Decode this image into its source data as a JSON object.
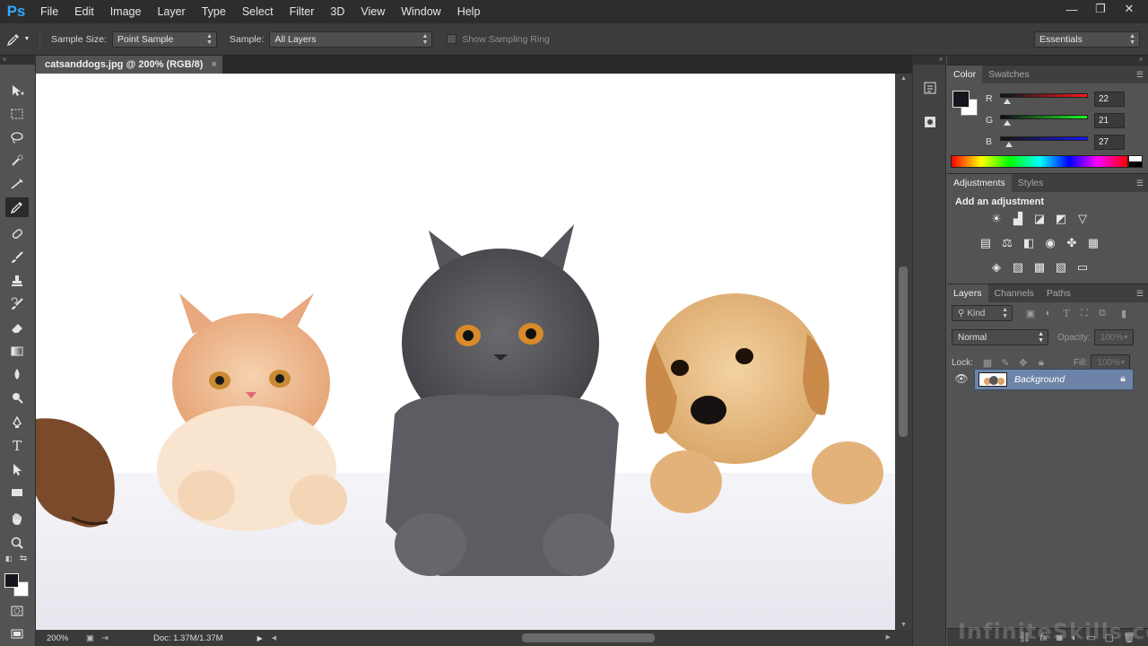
{
  "app": {
    "logo": "Ps"
  },
  "menu": [
    "File",
    "Edit",
    "Image",
    "Layer",
    "Type",
    "Select",
    "Filter",
    "3D",
    "View",
    "Window",
    "Help"
  ],
  "window_controls": {
    "minimize": "—",
    "restore": "❐",
    "close": "✕"
  },
  "options": {
    "sample_size_label": "Sample Size:",
    "sample_size_value": "Point Sample",
    "sample_label": "Sample:",
    "sample_value": "All Layers",
    "show_ring_label": "Show Sampling Ring",
    "show_ring_checked": false,
    "workspace": "Essentials"
  },
  "document": {
    "tab_title": "catsanddogs.jpg @ 200% (RGB/8)",
    "close": "×",
    "zoom": "200%",
    "doc_info": "Doc: 1.37M/1.37M"
  },
  "tools": [
    "move-tool",
    "marquee-tool",
    "lasso-tool",
    "quick-selection-tool",
    "crop-tool",
    "eyedropper-tool",
    "healing-brush-tool",
    "brush-tool",
    "clone-stamp-tool",
    "history-brush-tool",
    "eraser-tool",
    "gradient-tool",
    "blur-tool",
    "dodge-tool",
    "pen-tool",
    "type-tool",
    "path-selection-tool",
    "rectangle-tool",
    "hand-tool",
    "zoom-tool"
  ],
  "active_tool": "eyedropper-tool",
  "color_panel": {
    "tabs": [
      "Color",
      "Swatches"
    ],
    "active_tab": "Color",
    "foreground": "#16151b",
    "background": "#ffffff",
    "channels": [
      {
        "label": "R",
        "value": "22",
        "level": 0.086,
        "gradient": "linear-gradient(to right,#001b1b,#ff151b)"
      },
      {
        "label": "G",
        "value": "21",
        "level": 0.082,
        "gradient": "linear-gradient(to right,#16001b,#16ff1b)"
      },
      {
        "label": "B",
        "value": "27",
        "level": 0.106,
        "gradient": "linear-gradient(to right,#161500,#1615ff)"
      }
    ]
  },
  "adjustments_panel": {
    "tabs": [
      "Adjustments",
      "Styles"
    ],
    "active_tab": "Adjustments",
    "title": "Add an adjustment"
  },
  "layers_panel": {
    "tabs": [
      "Layers",
      "Channels",
      "Paths"
    ],
    "active_tab": "Layers",
    "kind_filter": "Kind",
    "blend_mode": "Normal",
    "opacity_label": "Opacity:",
    "opacity_value": "100%",
    "lock_label": "Lock:",
    "fill_label": "Fill:",
    "fill_value": "100%",
    "layers": [
      {
        "name": "Background",
        "visible": true,
        "locked": true
      }
    ]
  },
  "watermark": "InfiniteSkills.com"
}
